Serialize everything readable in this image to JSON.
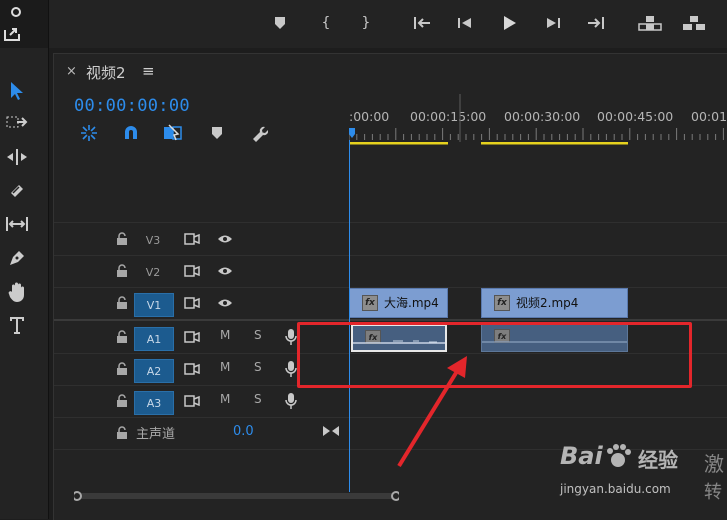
{
  "sequence": {
    "tab_close": "×",
    "tab_title": "视频2",
    "tab_menu": "≡",
    "timecode": "00:00:00:00"
  },
  "ruler": {
    "labels": [
      ":00:00",
      "00:00:15:00",
      "00:00:30:00",
      "00:00:45:00",
      "00:01:"
    ]
  },
  "video_tracks": [
    {
      "name": "V3",
      "active": false
    },
    {
      "name": "V2",
      "active": false
    },
    {
      "name": "V1",
      "active": true
    }
  ],
  "audio_tracks": [
    {
      "name": "A1",
      "mute": "M",
      "solo": "S"
    },
    {
      "name": "A2",
      "mute": "M",
      "solo": "S"
    },
    {
      "name": "A3",
      "mute": "M",
      "solo": "S"
    }
  ],
  "master": {
    "label": "主声道",
    "value": "0.0"
  },
  "clips": {
    "video": [
      {
        "name": "大海.mp4",
        "fx": "fx"
      },
      {
        "name": "视频2.mp4",
        "fx": "fx"
      }
    ],
    "audio": [
      {
        "fx": "fx"
      },
      {
        "fx": "fx"
      }
    ]
  },
  "watermark": {
    "brand_left": "Bai",
    "brand_right": "经验",
    "url": "jingyan.baidu.com",
    "side_text_1": "激",
    "side_text_2": "转"
  },
  "colors": {
    "accent_blue": "#2d8ceb",
    "clip_video": "#7c9dd1",
    "clip_audio": "#465f80",
    "highlight_red": "#e3262b",
    "work_area_yellow": "#e6d21e"
  }
}
